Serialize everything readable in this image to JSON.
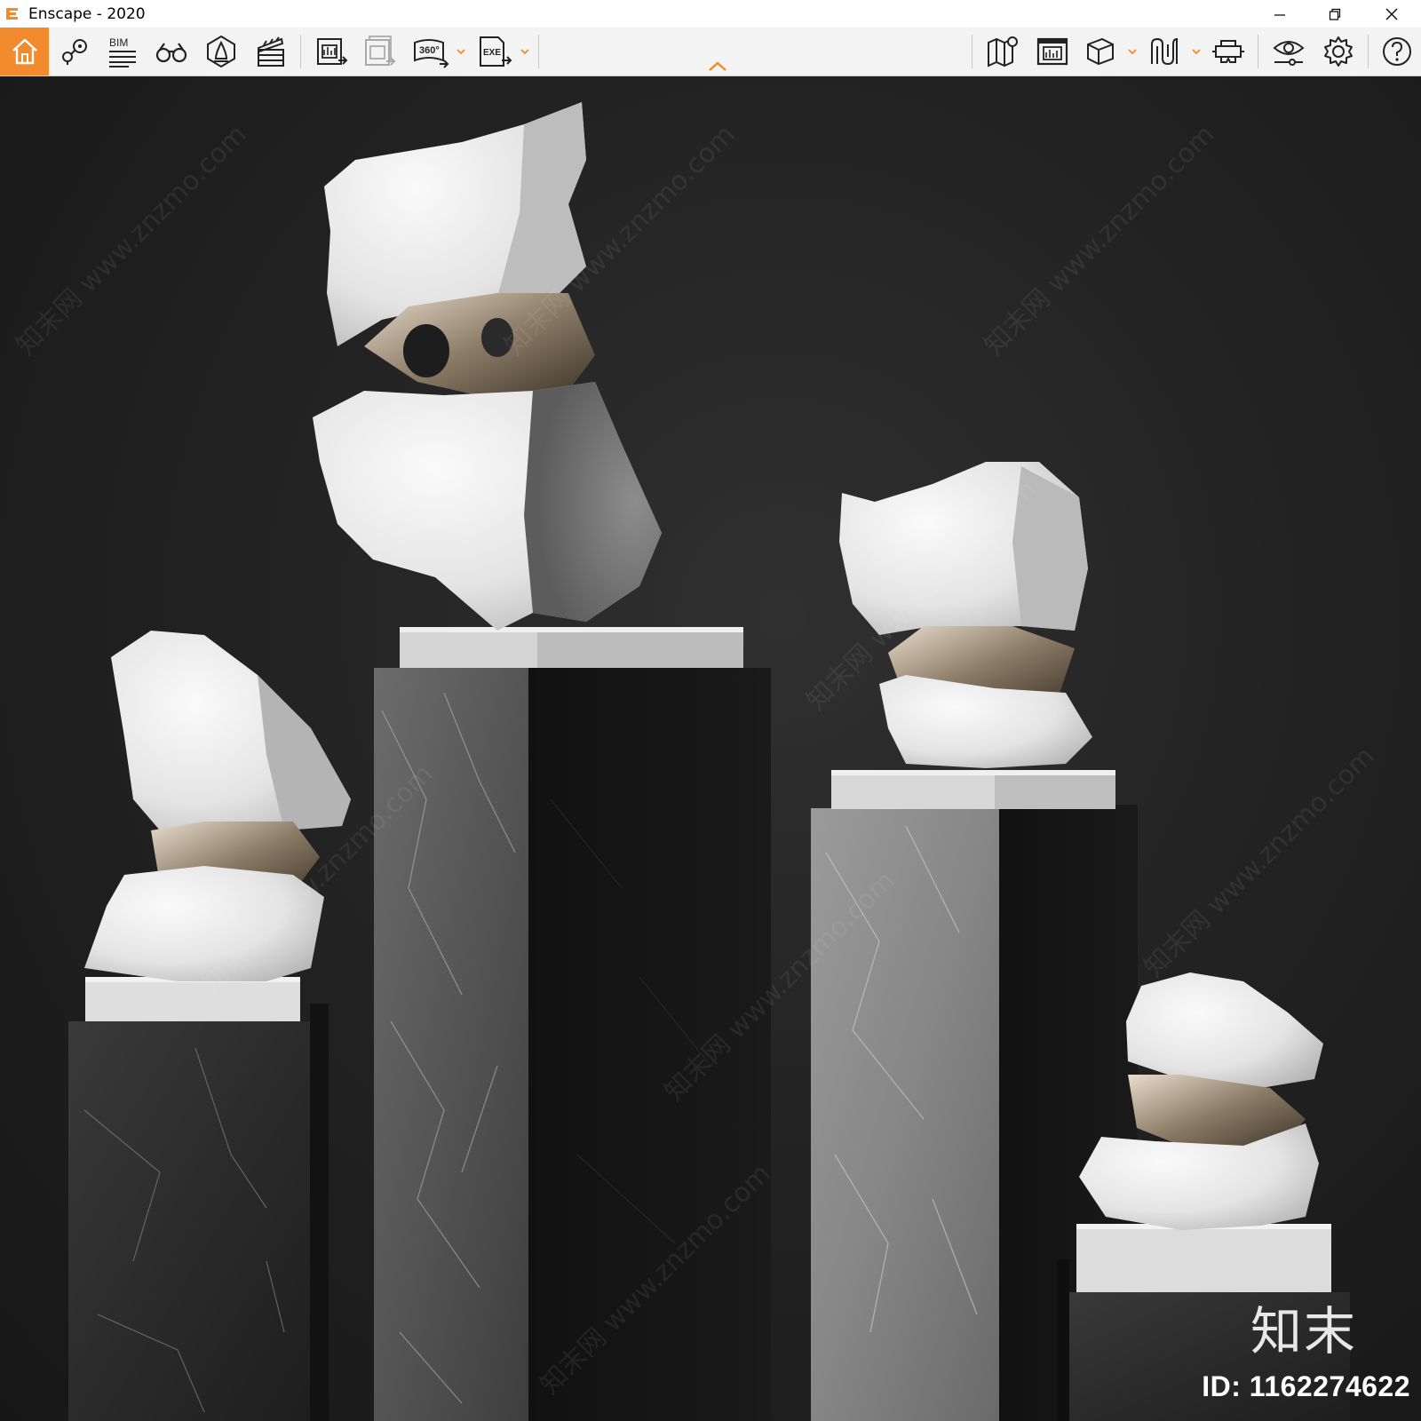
{
  "window": {
    "title": "Enscape - 2020",
    "minimize_icon": "minimize-icon",
    "restore_icon": "restore-icon",
    "close_icon": "close-icon"
  },
  "toolbar": {
    "accent_color": "#f28a2e",
    "left_tools": [
      {
        "name": "home",
        "icon": "home-icon"
      },
      {
        "name": "views",
        "icon": "view-management-icon"
      },
      {
        "name": "bim",
        "icon": "bim-icon",
        "label": "BIM"
      },
      {
        "name": "binoculars",
        "icon": "binoculars-icon"
      },
      {
        "name": "atmosphere",
        "icon": "atmosphere-icon"
      },
      {
        "name": "video-editor",
        "icon": "clapperboard-icon"
      },
      {
        "name": "render-image",
        "icon": "render-image-icon"
      },
      {
        "name": "batch-render",
        "icon": "batch-render-icon"
      },
      {
        "name": "panorama",
        "icon": "panorama-360-icon",
        "label": "360°"
      },
      {
        "name": "export-exe",
        "icon": "export-exe-icon",
        "label": "EXE"
      }
    ],
    "right_tools": [
      {
        "name": "map",
        "icon": "map-icon"
      },
      {
        "name": "screenshot",
        "icon": "screenshot-icon"
      },
      {
        "name": "asset-library",
        "icon": "cube-icon"
      },
      {
        "name": "material-editor",
        "icon": "material-editor-icon"
      },
      {
        "name": "vr-headset",
        "icon": "vr-headset-icon"
      },
      {
        "name": "visual-settings",
        "icon": "eye-settings-icon"
      },
      {
        "name": "settings",
        "icon": "gear-icon"
      },
      {
        "name": "help",
        "icon": "help-icon"
      }
    ]
  },
  "viewport": {
    "watermark_brand": "知末",
    "watermark_id": "ID: 1162274622",
    "watermark_diagonal": "知末网 www.znzmo.com"
  }
}
